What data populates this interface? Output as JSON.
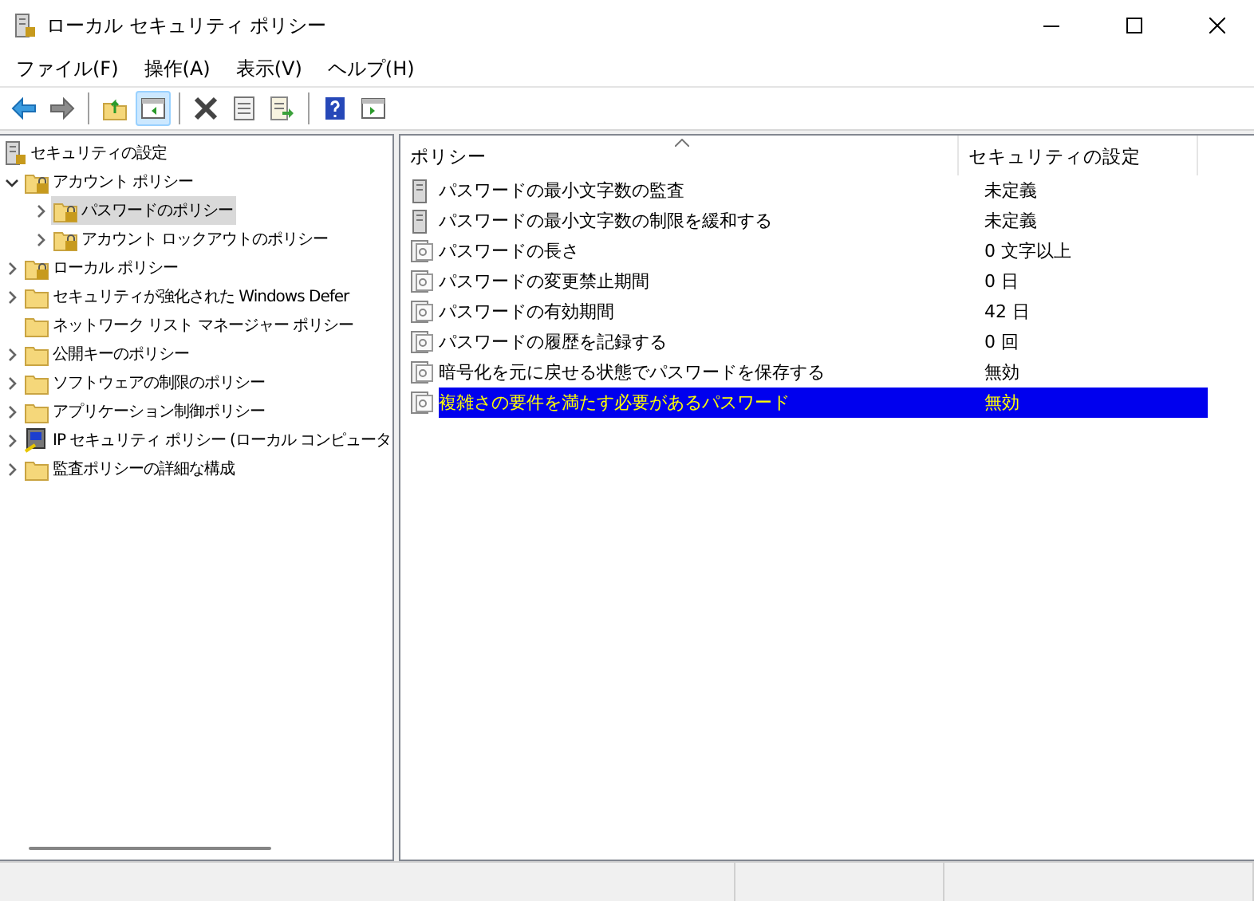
{
  "window": {
    "title": "ローカル セキュリティ ポリシー"
  },
  "menu": [
    "ファイル(F)",
    "操作(A)",
    "表示(V)",
    "ヘルプ(H)"
  ],
  "toolbar": [
    {
      "kind": "back",
      "selected": false
    },
    {
      "kind": "forward",
      "selected": false
    },
    {
      "kind": "sep"
    },
    {
      "kind": "up",
      "selected": false
    },
    {
      "kind": "tree",
      "selected": true
    },
    {
      "kind": "sep"
    },
    {
      "kind": "delete",
      "selected": false
    },
    {
      "kind": "props",
      "selected": false
    },
    {
      "kind": "export",
      "selected": false
    },
    {
      "kind": "sep"
    },
    {
      "kind": "help",
      "selected": false
    },
    {
      "kind": "view",
      "selected": false
    }
  ],
  "tree": [
    {
      "label": "セキュリティの設定",
      "kind": "server",
      "selected": false,
      "children": [
        {
          "label": "アカウント ポリシー",
          "kind": "lock",
          "expandable": true,
          "expanded": true,
          "selected": false,
          "children": [
            {
              "label": "パスワードのポリシー",
              "kind": "lock",
              "expandable": true,
              "expanded": false,
              "selected": true
            },
            {
              "label": "アカウント ロックアウトのポリシー",
              "kind": "lock",
              "expandable": true,
              "expanded": false,
              "selected": false
            }
          ]
        },
        {
          "label": "ローカル ポリシー",
          "kind": "lock",
          "expandable": true,
          "expanded": false,
          "selected": false
        },
        {
          "label": "セキュリティが強化された Windows Defer",
          "kind": "folder",
          "expandable": true,
          "expanded": false,
          "selected": false
        },
        {
          "label": "ネットワーク リスト マネージャー ポリシー",
          "kind": "folder",
          "expandable": false,
          "selected": false
        },
        {
          "label": "公開キーのポリシー",
          "kind": "folder",
          "expandable": true,
          "expanded": false,
          "selected": false
        },
        {
          "label": "ソフトウェアの制限のポリシー",
          "kind": "folder",
          "expandable": true,
          "expanded": false,
          "selected": false
        },
        {
          "label": "アプリケーション制御ポリシー",
          "kind": "folder",
          "expandable": true,
          "expanded": false,
          "selected": false
        },
        {
          "label": "IP セキュリティ ポリシー (ローカル コンピュータ",
          "kind": "ip",
          "expandable": true,
          "expanded": false,
          "selected": false
        },
        {
          "label": "監査ポリシーの詳細な構成",
          "kind": "folder",
          "expandable": true,
          "expanded": false,
          "selected": false
        }
      ]
    }
  ],
  "table": {
    "columns": [
      "ポリシー",
      "セキュリティの設定"
    ],
    "rows": [
      {
        "kind": "audit",
        "policy": "パスワードの最小文字数の監査",
        "setting": "未定義",
        "selected": false
      },
      {
        "kind": "audit",
        "policy": "パスワードの最小文字数の制限を緩和する",
        "setting": "未定義",
        "selected": false
      },
      {
        "kind": "policy",
        "policy": "パスワードの長さ",
        "setting": "0 文字以上",
        "selected": false
      },
      {
        "kind": "policy",
        "policy": "パスワードの変更禁止期間",
        "setting": "0 日",
        "selected": false
      },
      {
        "kind": "policy",
        "policy": "パスワードの有効期間",
        "setting": "42 日",
        "selected": false
      },
      {
        "kind": "policy",
        "policy": "パスワードの履歴を記録する",
        "setting": "0 回",
        "selected": false
      },
      {
        "kind": "policy",
        "policy": "暗号化を元に戻せる状態でパスワードを保存する",
        "setting": "無効",
        "selected": false
      },
      {
        "kind": "policy",
        "policy": "複雑さの要件を満たす必要があるパスワード",
        "setting": "無効",
        "selected": true
      }
    ]
  }
}
